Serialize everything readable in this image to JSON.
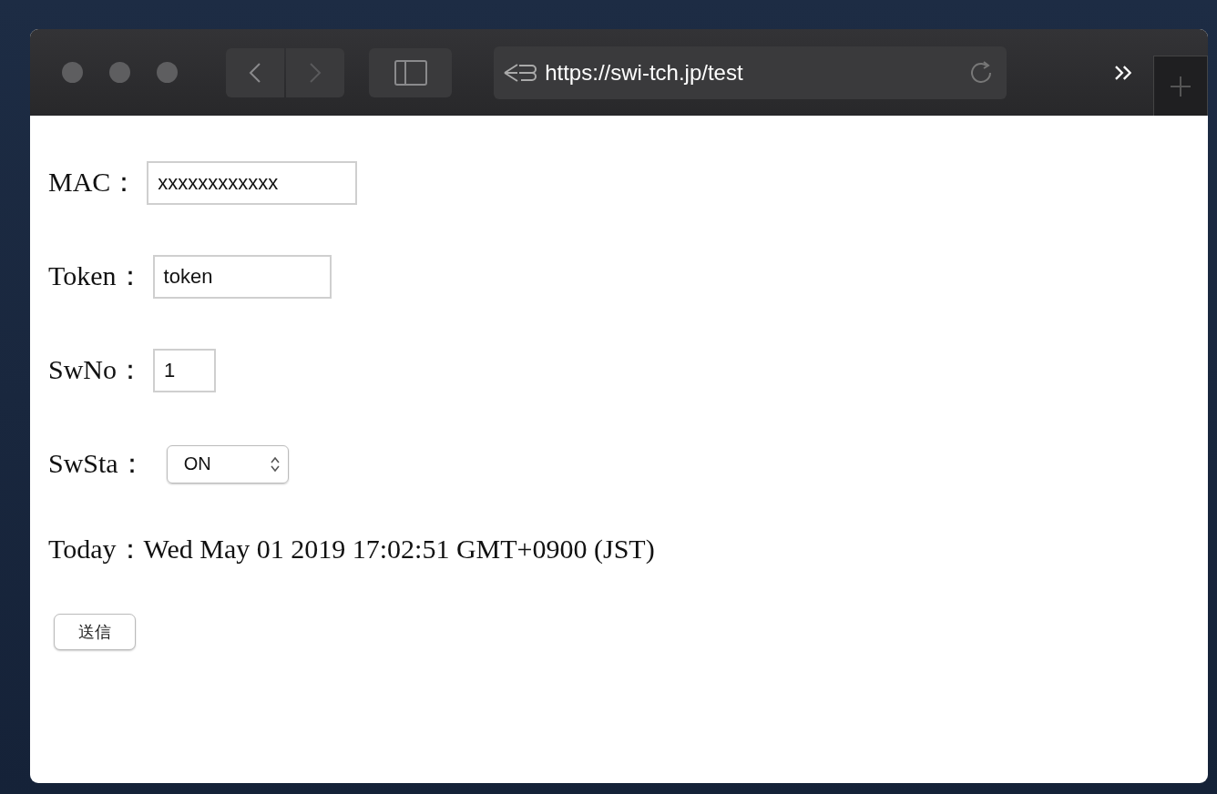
{
  "browser": {
    "url": "https://swi-tch.jp/test"
  },
  "form": {
    "fields": [
      {
        "label": "MAC：",
        "kind": "text",
        "value": "xxxxxxxxxxxx"
      },
      {
        "label": "Token：",
        "kind": "text",
        "value": "token"
      },
      {
        "label": "SwNo：",
        "kind": "number",
        "value": "1"
      },
      {
        "label": "SwSta：",
        "kind": "select",
        "value": "ON"
      }
    ],
    "today": "Today：Wed May 01 2019 17:02:51 GMT+0900 (JST)",
    "submit": "送信"
  }
}
